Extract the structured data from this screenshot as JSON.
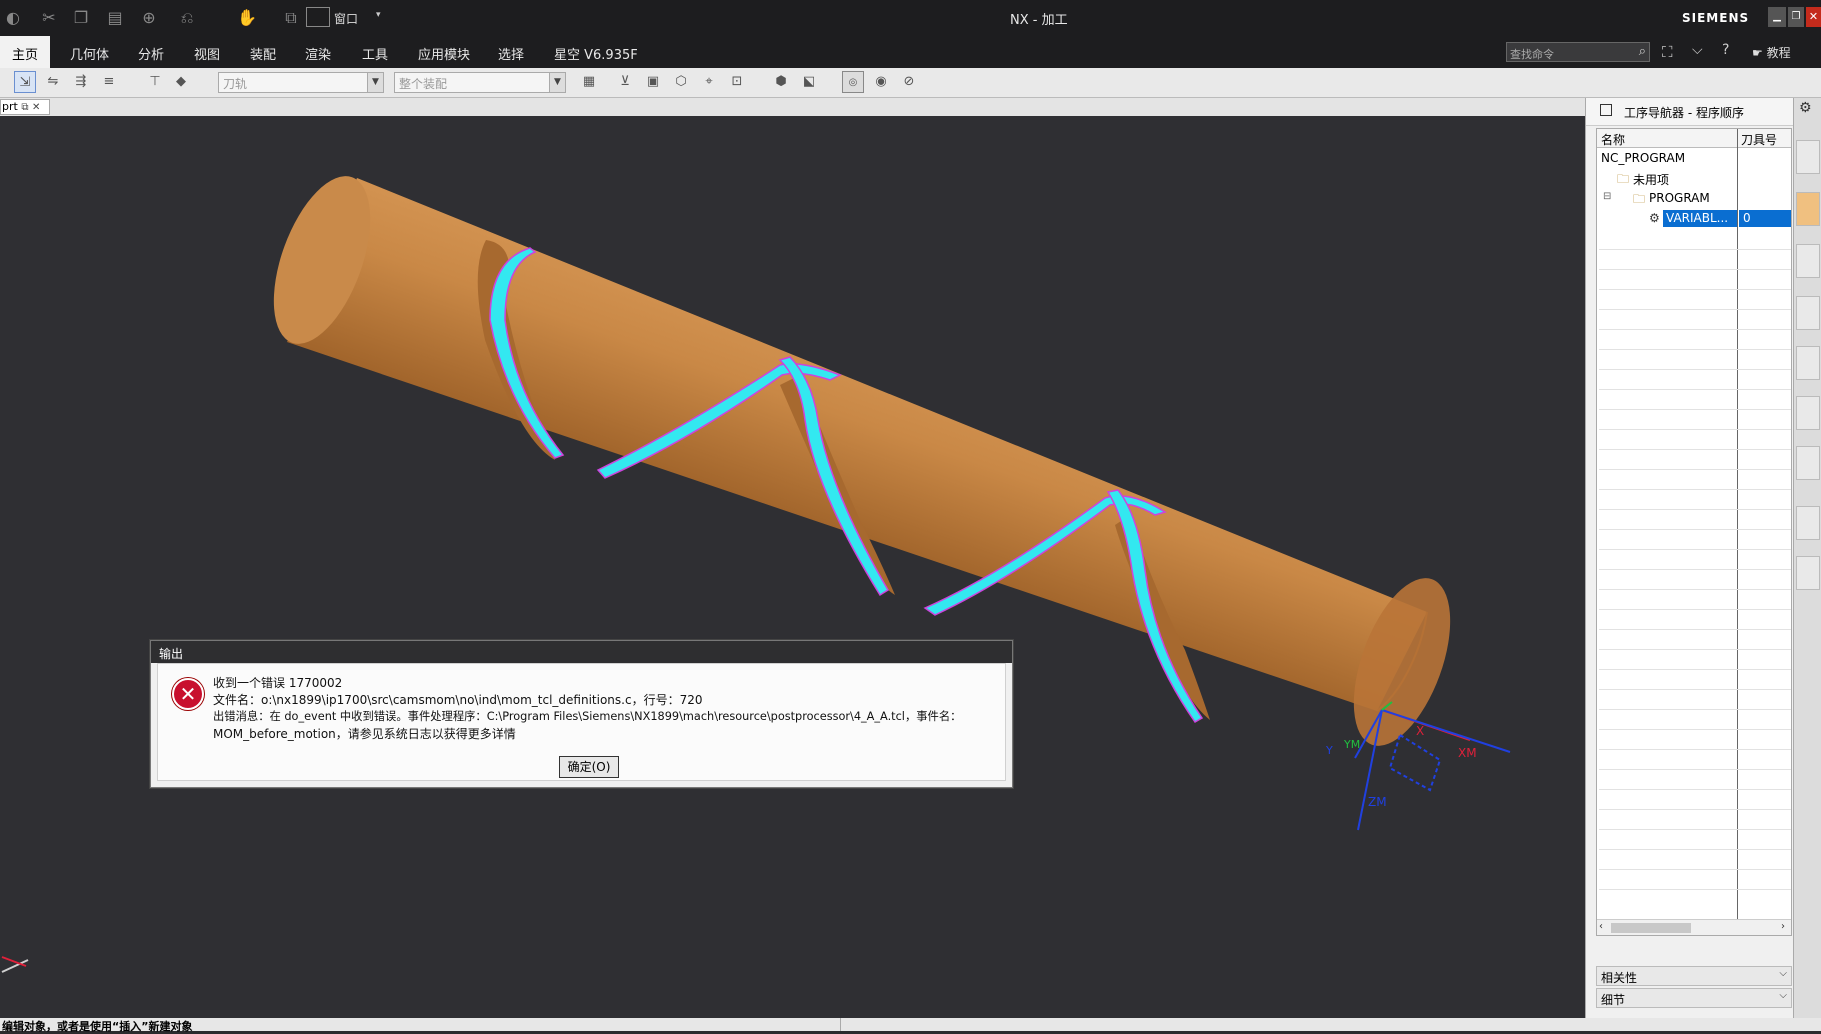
{
  "window": {
    "title": "NX - 加工",
    "brand": "SIEMENS",
    "window_controls": [
      "minimize",
      "restore",
      "close"
    ]
  },
  "quick_access": {
    "window_menu_label": "窗口"
  },
  "menu": {
    "items": [
      "主页",
      "几何体",
      "分析",
      "视图",
      "装配",
      "渲染",
      "工具",
      "应用模块",
      "选择",
      "星空 V6.935F"
    ],
    "active": "主页",
    "search_placeholder": "查找命令",
    "tutorial_label": "教程"
  },
  "selection_bar": {
    "filter_combo": "刀轨",
    "scope_combo": "整个装配"
  },
  "document_tab": {
    "label": "prt"
  },
  "dialog": {
    "title": "输出",
    "line1": "收到一个错误 1770002",
    "line2": "文件名：o:\\nx1899\\ip1700\\src\\camsmom\\no\\ind\\mom_tcl_definitions.c，行号：720",
    "line3": "出错消息：在 do_event 中收到错误。事件处理程序：C:\\Program Files\\Siemens\\NX1899\\mach\\resource\\postprocessor\\4_A_A.tcl，事件名：",
    "line4": "MOM_before_motion，请参见系统日志以获得更多详情",
    "ok_label": "确定(O)"
  },
  "navigator": {
    "title": "工序导航器 - 程序顺序",
    "col_name": "名称",
    "col_tool": "刀具号",
    "rows": [
      {
        "name": "NC_PROGRAM",
        "tool": ""
      },
      {
        "name": "未用项",
        "tool": ""
      },
      {
        "name": "PROGRAM",
        "tool": ""
      },
      {
        "name": "VARIABL...",
        "tool": "0"
      }
    ],
    "footer_relevance": "相关性",
    "footer_detail": "细节"
  },
  "axes": {
    "x_label": "X",
    "xm_label": "XM",
    "y_label": "Y",
    "ym_label": "YM",
    "zm_label": "ZM"
  },
  "status": {
    "text": "编辑对象，或者是使用“插入”新建对象"
  },
  "colors": {
    "cylinder": "#c07a3a",
    "toolpath": "#33e8f0",
    "toolpath_edge": "#cc44dd",
    "viewport_bg": "#2f2f33",
    "error_red": "#c8102e"
  }
}
